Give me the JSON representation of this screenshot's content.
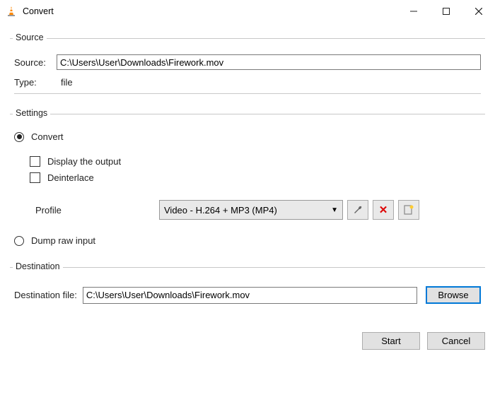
{
  "window": {
    "title": "Convert"
  },
  "source": {
    "group_label": "Source",
    "label": "Source:",
    "value": "C:\\Users\\User\\Downloads\\Firework.mov",
    "type_label": "Type:",
    "type_value": "file"
  },
  "settings": {
    "group_label": "Settings",
    "convert_label": "Convert",
    "display_output_label": "Display the output",
    "deinterlace_label": "Deinterlace",
    "profile_label": "Profile",
    "profile_selected": "Video - H.264 + MP3 (MP4)",
    "dump_label": "Dump raw input"
  },
  "destination": {
    "group_label": "Destination",
    "label": "Destination file:",
    "value": "C:\\Users\\User\\Downloads\\Firework.mov",
    "browse_label": "Browse"
  },
  "footer": {
    "start_label": "Start",
    "cancel_label": "Cancel"
  }
}
